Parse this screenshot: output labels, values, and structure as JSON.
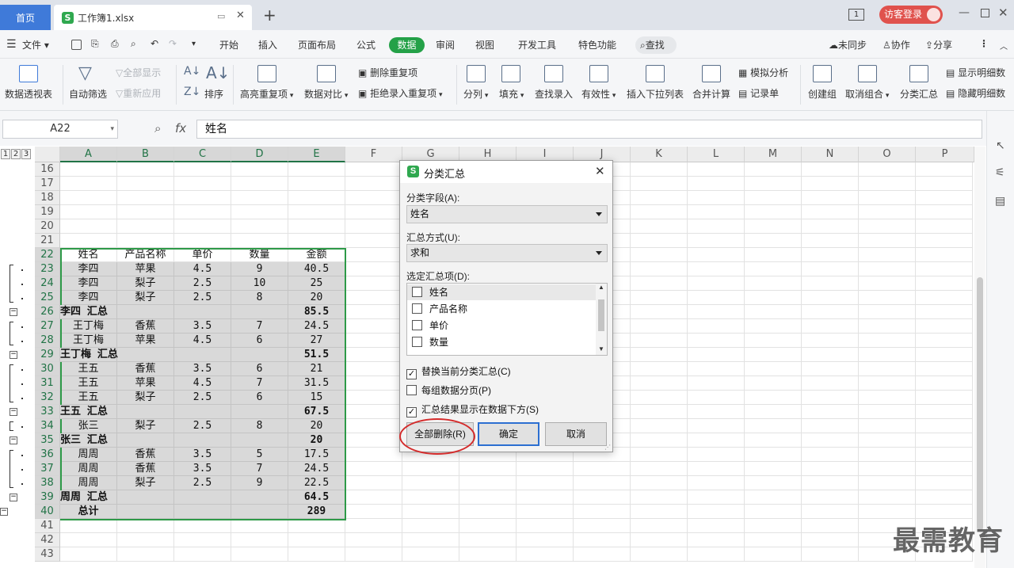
{
  "tabs": {
    "home": "首页",
    "file": "工作簿1.xlsx"
  },
  "titlebar": {
    "visitor_login": "访客登录"
  },
  "menu": {
    "file": "文件",
    "items": [
      "开始",
      "插入",
      "页面布局",
      "公式",
      "数据",
      "审阅",
      "视图",
      "开发工具",
      "特色功能"
    ],
    "search": "查找",
    "sync": "未同步",
    "collab": "协作",
    "share": "分享"
  },
  "ribbon": {
    "pivot": "数据透视表",
    "autofilter": "自动筛选",
    "showall": "全部显示",
    "reapply": "重新应用",
    "sort": "排序",
    "highlight_dup": "高亮重复项",
    "compare": "数据对比",
    "remove_dup": "删除重复项",
    "reject_dup": "拒绝录入重复项",
    "split": "分列",
    "fill": "填充",
    "lookup": "查找录入",
    "validity": "有效性",
    "dropdown": "插入下拉列表",
    "consolidate": "合并计算",
    "whatif": "模拟分析",
    "record": "记录单",
    "group": "创建组",
    "ungroup": "取消组合",
    "subtotal": "分类汇总",
    "show_detail": "显示明细数",
    "hide_detail": "隐藏明细数"
  },
  "formula": {
    "namebox": "A22",
    "fx": "fx",
    "value": "姓名"
  },
  "outline_levels": [
    "1",
    "2",
    "3"
  ],
  "columns": [
    "A",
    "B",
    "C",
    "D",
    "E",
    "F",
    "G",
    "H",
    "I",
    "J",
    "K",
    "L",
    "M",
    "N",
    "O",
    "P"
  ],
  "rows": [
    {
      "n": "16",
      "cells": [
        "",
        "",
        "",
        "",
        ""
      ]
    },
    {
      "n": "17",
      "cells": [
        "",
        "",
        "",
        "",
        ""
      ]
    },
    {
      "n": "18",
      "cells": [
        "",
        "",
        "",
        "",
        ""
      ]
    },
    {
      "n": "19",
      "cells": [
        "",
        "",
        "",
        "",
        ""
      ]
    },
    {
      "n": "20",
      "cells": [
        "",
        "",
        "",
        "",
        ""
      ]
    },
    {
      "n": "21",
      "cells": [
        "",
        "",
        "",
        "",
        ""
      ]
    },
    {
      "n": "22",
      "cells": [
        "姓名",
        "产品名称",
        "单价",
        "数量",
        "金额"
      ]
    },
    {
      "n": "23",
      "cells": [
        "李四",
        "苹果",
        "4.5",
        "9",
        "40.5"
      ]
    },
    {
      "n": "24",
      "cells": [
        "李四",
        "梨子",
        "2.5",
        "10",
        "25"
      ]
    },
    {
      "n": "25",
      "cells": [
        "李四",
        "梨子",
        "2.5",
        "8",
        "20"
      ]
    },
    {
      "n": "26",
      "cells": [
        "李四 汇总",
        "",
        "",
        "",
        "85.5"
      ],
      "bold": true
    },
    {
      "n": "27",
      "cells": [
        "王丁梅",
        "香蕉",
        "3.5",
        "7",
        "24.5"
      ]
    },
    {
      "n": "28",
      "cells": [
        "王丁梅",
        "苹果",
        "4.5",
        "6",
        "27"
      ]
    },
    {
      "n": "29",
      "cells": [
        "王丁梅 汇总",
        "",
        "",
        "",
        "51.5"
      ],
      "bold": true
    },
    {
      "n": "30",
      "cells": [
        "王五",
        "香蕉",
        "3.5",
        "6",
        "21"
      ]
    },
    {
      "n": "31",
      "cells": [
        "王五",
        "苹果",
        "4.5",
        "7",
        "31.5"
      ]
    },
    {
      "n": "32",
      "cells": [
        "王五",
        "梨子",
        "2.5",
        "6",
        "15"
      ]
    },
    {
      "n": "33",
      "cells": [
        "王五 汇总",
        "",
        "",
        "",
        "67.5"
      ],
      "bold": true
    },
    {
      "n": "34",
      "cells": [
        "张三",
        "梨子",
        "2.5",
        "8",
        "20"
      ]
    },
    {
      "n": "35",
      "cells": [
        "张三 汇总",
        "",
        "",
        "",
        "20"
      ],
      "bold": true
    },
    {
      "n": "36",
      "cells": [
        "周周",
        "香蕉",
        "3.5",
        "5",
        "17.5"
      ]
    },
    {
      "n": "37",
      "cells": [
        "周周",
        "香蕉",
        "3.5",
        "7",
        "24.5"
      ]
    },
    {
      "n": "38",
      "cells": [
        "周周",
        "梨子",
        "2.5",
        "9",
        "22.5"
      ]
    },
    {
      "n": "39",
      "cells": [
        "周周 汇总",
        "",
        "",
        "",
        "64.5"
      ],
      "bold": true
    },
    {
      "n": "40",
      "cells": [
        "总计",
        "",
        "",
        "",
        "289"
      ],
      "bold": true
    },
    {
      "n": "41",
      "cells": [
        "",
        "",
        "",
        "",
        ""
      ]
    },
    {
      "n": "42",
      "cells": [
        "",
        "",
        "",
        "",
        ""
      ]
    },
    {
      "n": "43",
      "cells": [
        "",
        "",
        "",
        "",
        ""
      ]
    }
  ],
  "dialog": {
    "title": "分类汇总",
    "field_label": "分类字段(A):",
    "field_value": "姓名",
    "method_label": "汇总方式(U):",
    "method_value": "求和",
    "items_label": "选定汇总项(D):",
    "items": [
      {
        "label": "姓名",
        "checked": false
      },
      {
        "label": "产品名称",
        "checked": false
      },
      {
        "label": "单价",
        "checked": false
      },
      {
        "label": "数量",
        "checked": false
      }
    ],
    "opt_replace": "替换当前分类汇总(C)",
    "opt_replace_checked": true,
    "opt_pagebreak": "每组数据分页(P)",
    "opt_pagebreak_checked": false,
    "opt_below": "汇总结果显示在数据下方(S)",
    "opt_below_checked": true,
    "btn_remove_all": "全部删除(R)",
    "btn_ok": "确定",
    "btn_cancel": "取消"
  },
  "watermark": "最需教育"
}
